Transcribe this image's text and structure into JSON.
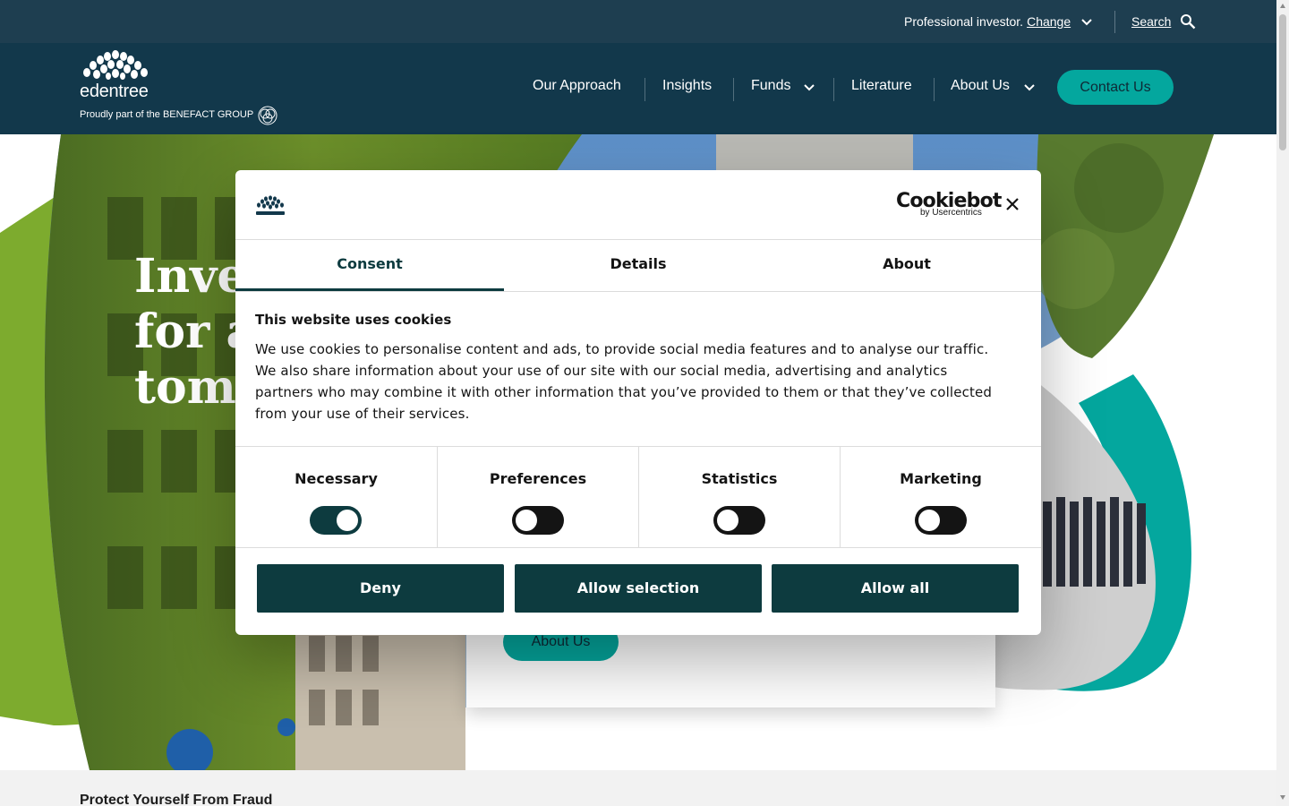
{
  "utility": {
    "investor_text": "Professional investor.",
    "change_label": "Change",
    "search_label": "Search"
  },
  "header": {
    "logo_word": "edentree",
    "logo_tagline": "Proudly part of the BENEFACT GROUP",
    "nav": [
      "Our Approach",
      "Insights",
      "Funds",
      "Literature",
      "About Us"
    ],
    "contact_label": "Contact Us"
  },
  "hero": {
    "title": "Inve\nfor a\ntomo",
    "about_button": "About Us"
  },
  "fraud": {
    "heading": "Protect Yourself From Fraud"
  },
  "cookie_dialog": {
    "brand": "Cookiebot",
    "brand_sub": "by Usercentrics",
    "tabs": [
      "Consent",
      "Details",
      "About"
    ],
    "active_tab": "Consent",
    "title": "This website uses cookies",
    "body": "We use cookies to personalise content and ads, to provide social media features and to analyse our traffic. We also share information about your use of our site with our social media, advertising and analytics partners who may combine it with other information that you’ve provided to them or that they’ve collected from your use of their services.",
    "categories": [
      {
        "label": "Necessary",
        "enabled": true
      },
      {
        "label": "Preferences",
        "enabled": false
      },
      {
        "label": "Statistics",
        "enabled": false
      },
      {
        "label": "Marketing",
        "enabled": false
      }
    ],
    "buttons": {
      "deny": "Deny",
      "allow_selection": "Allow selection",
      "allow_all": "Allow all"
    }
  },
  "colors": {
    "top_bar": "#1e3e50",
    "header": "#12384b",
    "teal_accent": "#04a79e",
    "dialog_primary": "#0d3b3f",
    "hero_green": "#7dab2e"
  }
}
